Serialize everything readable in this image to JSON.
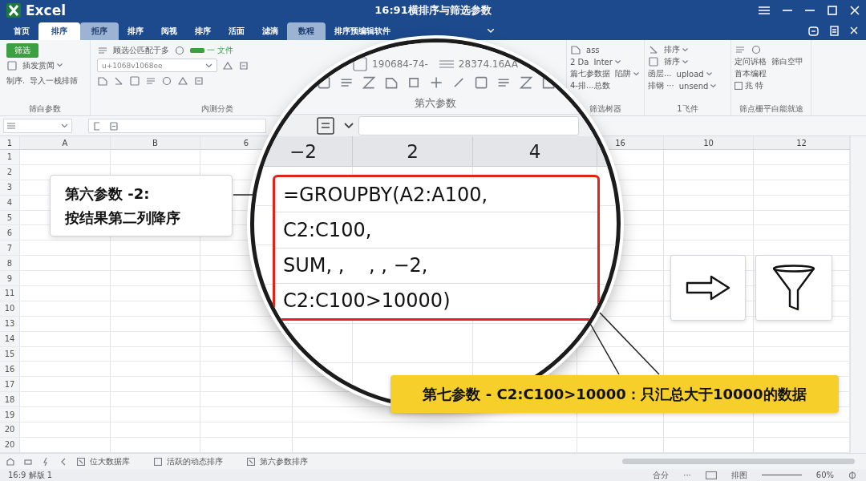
{
  "window": {
    "app": "Excel",
    "title": "16:91横排序与筛选参数"
  },
  "tabs": [
    {
      "label": "首页",
      "selected": false,
      "highlighted": false
    },
    {
      "label": "排序",
      "selected": true,
      "highlighted": false
    },
    {
      "label": "拒序",
      "selected": false,
      "highlighted": true
    },
    {
      "label": "排序",
      "selected": false,
      "highlighted": false
    },
    {
      "label": "阅视",
      "selected": false,
      "highlighted": false
    },
    {
      "label": "排序",
      "selected": false,
      "highlighted": false
    },
    {
      "label": "活面",
      "selected": false,
      "highlighted": false
    },
    {
      "label": "滤滴",
      "selected": false,
      "highlighted": false
    },
    {
      "label": "数程",
      "selected": false,
      "highlighted": true
    },
    {
      "label": "排序预编辑软件",
      "selected": false,
      "highlighted": false
    }
  ],
  "ribbon": {
    "left_groups": [
      {
        "label": "筛白参数",
        "rows": [
          [
            {
              "kind": "primary",
              "text": "筛选"
            }
          ],
          [
            {
              "kind": "icon"
            },
            {
              "kind": "dropdown",
              "text": "插发赏闻"
            }
          ],
          [
            {
              "kind": "text",
              "text": "制序."
            },
            {
              "kind": "text",
              "text": "导入一栈排筛"
            }
          ]
        ]
      },
      {
        "label": "内测分类",
        "rows": [
          [
            {
              "kind": "icon"
            },
            {
              "kind": "text",
              "text": "顾选公匹配于多"
            },
            {
              "kind": "icon"
            },
            {
              "kind": "bar",
              "text": "一 文件"
            }
          ],
          [
            {
              "kind": "field",
              "text": "u+1068v1068ee"
            },
            {
              "kind": "icon"
            },
            {
              "kind": "icon"
            }
          ],
          [
            {
              "kind": "icon"
            },
            {
              "kind": "icon"
            },
            {
              "kind": "icon"
            },
            {
              "kind": "icon"
            },
            {
              "kind": "icon"
            },
            {
              "kind": "icon"
            },
            {
              "kind": "icon"
            }
          ]
        ]
      }
    ],
    "right_groups": [
      {
        "label": "筛选树器",
        "rows": [
          [
            {
              "kind": "icon"
            },
            {
              "kind": "text",
              "text": "ass"
            }
          ],
          [
            {
              "kind": "text",
              "text": "2 Da"
            },
            {
              "kind": "dropdown",
              "text": "Inter"
            }
          ],
          [
            {
              "kind": "text",
              "text": "篇七参数据"
            },
            {
              "kind": "dropdown",
              "text": "陷阱"
            }
          ],
          [
            {
              "kind": "text",
              "text": "4-排...总数"
            }
          ]
        ]
      },
      {
        "label": "1飞件",
        "rows": [
          [
            {
              "kind": "icon"
            },
            {
              "kind": "dropdown",
              "text": "排序"
            }
          ],
          [
            {
              "kind": "icon"
            },
            {
              "kind": "dropdown",
              "text": "筛序"
            }
          ],
          [
            {
              "kind": "text",
              "text": "函层..."
            },
            {
              "kind": "dropdown",
              "text": "upload"
            }
          ],
          [
            {
              "kind": "text",
              "text": "排钢 ···"
            },
            {
              "kind": "dropdown",
              "text": "unsend"
            }
          ]
        ]
      },
      {
        "label": "筛点栅平白能就途",
        "rows": [
          [
            {
              "kind": "icon"
            },
            {
              "kind": "icon"
            }
          ],
          [
            {
              "kind": "text",
              "text": "定问诉格"
            },
            {
              "kind": "text",
              "text": "筛白空甲"
            }
          ],
          [
            {
              "kind": "text",
              "text": "首本编程"
            }
          ],
          [
            {
              "kind": "check",
              "text": "兆 特",
              "checked": false
            }
          ]
        ]
      }
    ]
  },
  "sheet": {
    "corner": "1",
    "columns": [
      "A",
      "B",
      "6",
      "16",
      "10",
      "12"
    ],
    "row_numbers": [
      "1",
      "2",
      "3",
      "4",
      "5",
      "6",
      "7",
      "8",
      "9",
      "11",
      "10",
      "13",
      "14",
      "15",
      "16",
      "17",
      "18",
      "19",
      "20",
      "20"
    ]
  },
  "sheet_tabs": [
    "位大数据库",
    "活跃的动态排序",
    "第六参数排序"
  ],
  "status_bar": {
    "left": "16:9 解版 1",
    "items": [
      "合分",
      "···",
      "排图",
      "60%"
    ]
  },
  "magnifier": {
    "ribbon_texts": [
      "190684-74-",
      "28374.16AA"
    ],
    "group_label": "第六参数",
    "column_headers": [
      "−2",
      "2",
      "4"
    ],
    "formula_lines": [
      "=GROUPBY(A2:A100,",
      "C2:C100,",
      "SUM, ,    , , −2,",
      "C2:C100>10000)"
    ]
  },
  "callout_left": {
    "lines": [
      "第六参数 -2:",
      "按结果第二列降序"
    ]
  },
  "callout_bottom": {
    "text": "第七参数 - C2:C100>10000：只汇总大于10000的数据"
  }
}
